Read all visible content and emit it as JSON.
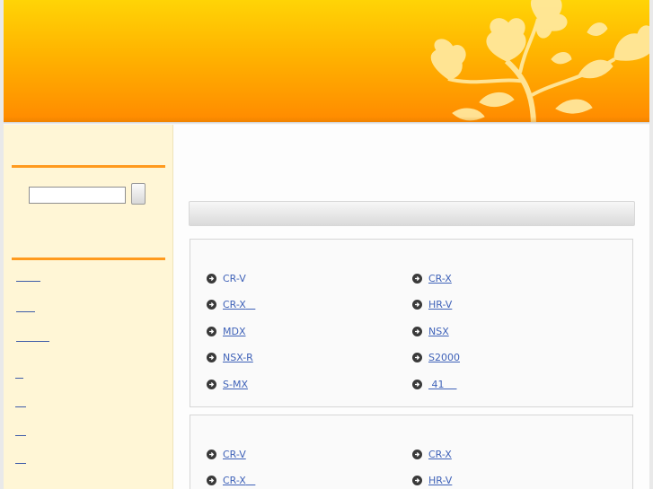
{
  "colors": {
    "header_top": "#ffd406",
    "header_bottom": "#ff8a00",
    "sidebar_bg": "#fff6d6",
    "accent_rule": "#ff9a1e",
    "link": "#3f62b8"
  },
  "search": {
    "value": "",
    "placeholder": "",
    "button_label": ""
  },
  "sidebar": {
    "links": [
      "",
      "",
      "",
      "",
      "",
      "",
      "",
      ""
    ]
  },
  "main": {
    "title": "",
    "panels": [
      {
        "items": [
          {
            "label": "CR-V",
            "underline": false
          },
          {
            "label": "CR-X",
            "underline": true
          },
          {
            "label": "CR-X",
            "underline": true
          },
          {
            "label": "HR-V",
            "underline": true
          },
          {
            "label": "MDX",
            "underline": true
          },
          {
            "label": "NSX",
            "underline": true
          },
          {
            "label": "NSX-R",
            "underline": true
          },
          {
            "label": "S2000",
            "underline": true
          },
          {
            "label": "S-MX",
            "underline": true
          },
          {
            "label": "41",
            "underline": true
          }
        ]
      },
      {
        "items": [
          {
            "label": "CR-V",
            "underline": true
          },
          {
            "label": "CR-X",
            "underline": true
          },
          {
            "label": "CR-X",
            "underline": true
          },
          {
            "label": "HR-V",
            "underline": true
          }
        ]
      }
    ]
  },
  "icons": {
    "bullet": "circle-arrow-right-icon",
    "decoration": "flower-ornament-icon"
  }
}
